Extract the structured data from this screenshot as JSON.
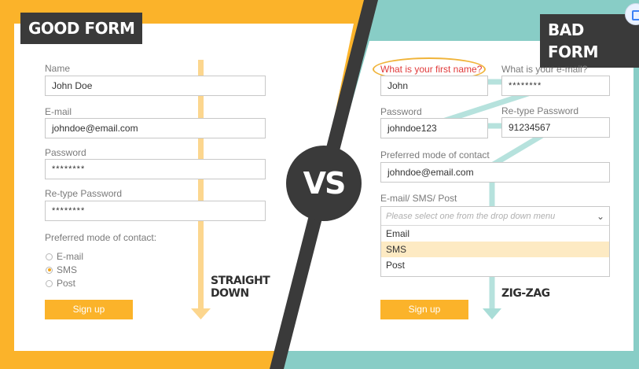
{
  "colors": {
    "accent_orange": "#fbb32a",
    "accent_teal": "#88cdc6",
    "dark": "#3a3a3a",
    "warning_red": "#e03a3a"
  },
  "vs_label": "VS",
  "good_form": {
    "title": "GOOD FORM",
    "name_label": "Name",
    "name_value": "John Doe",
    "email_label": "E-mail",
    "email_value": "johndoe@email.com",
    "password_label": "Password",
    "password_value": "********",
    "retype_label": "Re-type Password",
    "retype_value": "********",
    "contact_label": "Preferred mode of contact:",
    "contact_options": [
      "E-mail",
      "SMS",
      "Post"
    ],
    "contact_selected": "SMS",
    "signup_label": "Sign up",
    "arrow_note": [
      "STRAIGHT",
      "DOWN"
    ]
  },
  "bad_form": {
    "title": "BAD FORM",
    "firstname_label": "What is your first name?",
    "firstname_value": "John",
    "email_label": "What is your e-mail?",
    "email_value": "********",
    "password_label": "Password",
    "password_value": "johndoe123",
    "retype_label": "Re-type Password",
    "retype_value": "91234567",
    "contact_label": "Preferred mode of contact",
    "contact_value": "johndoe@email.com",
    "channel_label": "E-mail/ SMS/ Post",
    "dropdown_placeholder": "Please select one from the drop down menu",
    "dropdown_options": [
      "Email",
      "SMS",
      "Post"
    ],
    "dropdown_highlighted": "SMS",
    "signup_label": "Sign up",
    "arrow_note": "ZIG-ZAG"
  }
}
